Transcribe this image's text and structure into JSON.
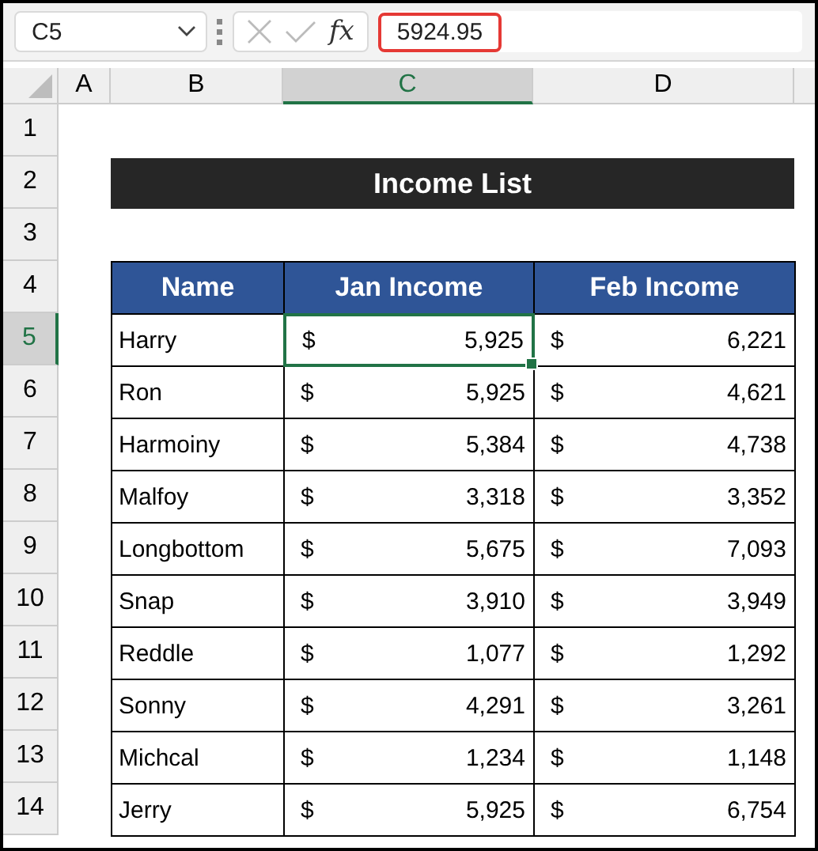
{
  "name_box": "C5",
  "formula_icons": {
    "fx": "fx"
  },
  "formula_value": "5924.95",
  "columns": [
    {
      "label": "A",
      "selected": false
    },
    {
      "label": "B",
      "selected": false
    },
    {
      "label": "C",
      "selected": true
    },
    {
      "label": "D",
      "selected": false
    }
  ],
  "row_headers": [
    {
      "label": "1",
      "selected": false
    },
    {
      "label": "2",
      "selected": false
    },
    {
      "label": "3",
      "selected": false
    },
    {
      "label": "4",
      "selected": false
    },
    {
      "label": "5",
      "selected": true
    },
    {
      "label": "6",
      "selected": false
    },
    {
      "label": "7",
      "selected": false
    },
    {
      "label": "8",
      "selected": false
    },
    {
      "label": "9",
      "selected": false
    },
    {
      "label": "10",
      "selected": false
    },
    {
      "label": "11",
      "selected": false
    },
    {
      "label": "12",
      "selected": false
    },
    {
      "label": "13",
      "selected": false
    },
    {
      "label": "14",
      "selected": false
    }
  ],
  "title": "Income List",
  "table": {
    "headers": [
      "Name",
      "Jan Income",
      "Feb Income"
    ],
    "rows": [
      {
        "name": "Harry",
        "jan": {
          "currency": "$",
          "amount": "5,925",
          "selected": true
        },
        "feb": {
          "currency": "$",
          "amount": "6,221",
          "selected": false
        }
      },
      {
        "name": "Ron",
        "jan": {
          "currency": "$",
          "amount": "5,925",
          "selected": false
        },
        "feb": {
          "currency": "$",
          "amount": "4,621",
          "selected": false
        }
      },
      {
        "name": "Harmoiny",
        "jan": {
          "currency": "$",
          "amount": "5,384",
          "selected": false
        },
        "feb": {
          "currency": "$",
          "amount": "4,738",
          "selected": false
        }
      },
      {
        "name": "Malfoy",
        "jan": {
          "currency": "$",
          "amount": "3,318",
          "selected": false
        },
        "feb": {
          "currency": "$",
          "amount": "3,352",
          "selected": false
        }
      },
      {
        "name": "Longbottom",
        "jan": {
          "currency": "$",
          "amount": "5,675",
          "selected": false
        },
        "feb": {
          "currency": "$",
          "amount": "7,093",
          "selected": false
        }
      },
      {
        "name": "Snap",
        "jan": {
          "currency": "$",
          "amount": "3,910",
          "selected": false
        },
        "feb": {
          "currency": "$",
          "amount": "3,949",
          "selected": false
        }
      },
      {
        "name": "Reddle",
        "jan": {
          "currency": "$",
          "amount": "1,077",
          "selected": false
        },
        "feb": {
          "currency": "$",
          "amount": "1,292",
          "selected": false
        }
      },
      {
        "name": "Sonny",
        "jan": {
          "currency": "$",
          "amount": "4,291",
          "selected": false
        },
        "feb": {
          "currency": "$",
          "amount": "3,261",
          "selected": false
        }
      },
      {
        "name": "Michcal",
        "jan": {
          "currency": "$",
          "amount": "1,234",
          "selected": false
        },
        "feb": {
          "currency": "$",
          "amount": "1,148",
          "selected": false
        }
      },
      {
        "name": "Jerry",
        "jan": {
          "currency": "$",
          "amount": "5,925",
          "selected": false
        },
        "feb": {
          "currency": "$",
          "amount": "6,754",
          "selected": false
        }
      }
    ]
  }
}
